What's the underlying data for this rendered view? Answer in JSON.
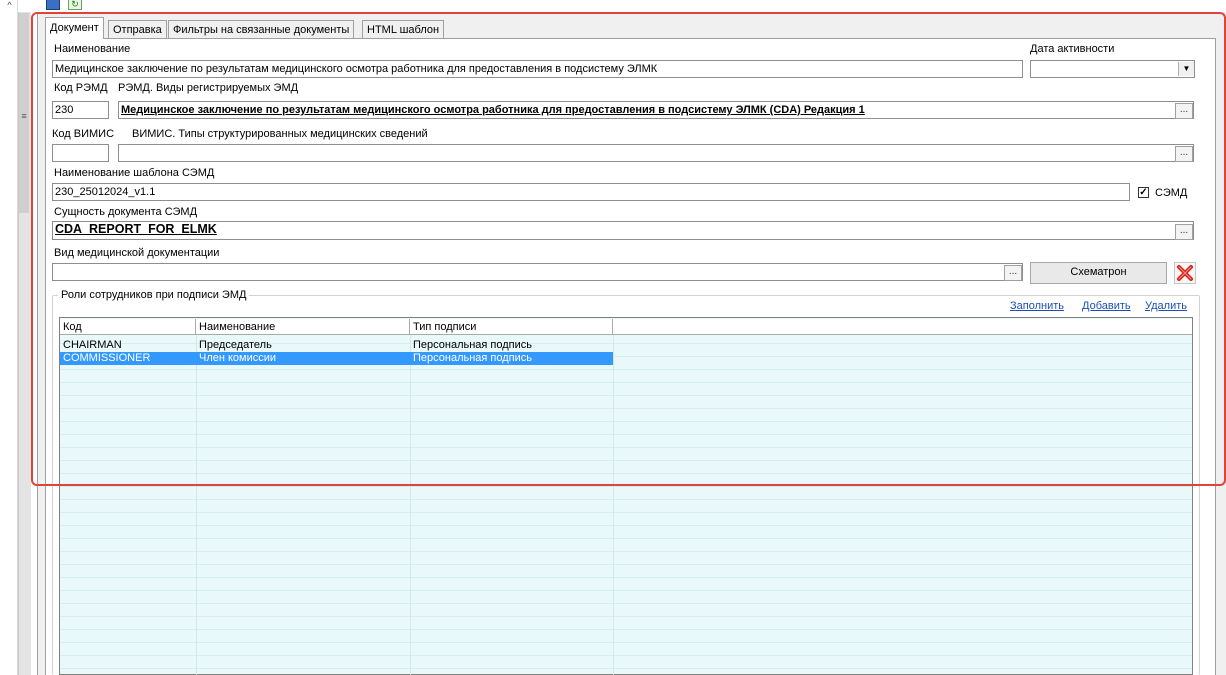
{
  "tabs": [
    {
      "label": "Документ",
      "active": true
    },
    {
      "label": "Отправка",
      "active": false
    },
    {
      "label": "Фильтры на связанные документы",
      "active": false
    },
    {
      "label": "HTML шаблон",
      "active": false
    }
  ],
  "form": {
    "name_label": "Наименование",
    "name_value": "Медицинское заключение по результатам медицинского осмотра работника для предоставления в подсистему ЭЛМК",
    "active_date_label": "Дата активности",
    "active_date_value": "",
    "remd_code_label": "Код РЭМД",
    "remd_types_label": "РЭМД. Виды регистрируемых ЭМД",
    "remd_code_value": "230",
    "remd_type_value": "Медицинское заключение по результатам медицинского осмотра работника для предоставления в подсистему ЭЛМК (CDA) Редакция 1",
    "vimis_code_label": "Код ВИМИС",
    "vimis_types_label": "ВИМИС. Типы структурированных медицинских сведений",
    "vimis_code_value": "",
    "vimis_type_value": "",
    "semd_template_label": "Наименование шаблона СЭМД",
    "semd_template_value": "230_25012024_v1.1",
    "semd_checkbox_label": "СЭМД",
    "semd_checkbox_checked": true,
    "semd_entity_label": "Сущность документа СЭМД",
    "semd_entity_value": "CDA_REPORT_FOR_ELMK",
    "med_doc_type_label": "Вид медицинской документации",
    "med_doc_type_value": "",
    "schematron_button": "Схематрон",
    "ellipsis": "..."
  },
  "roles": {
    "group_title": "Роли сотрудников при подписи ЭМД",
    "actions": {
      "fill": "Заполнить",
      "add": "Добавить",
      "delete": "Удалить"
    },
    "columns": [
      "Код",
      "Наименование",
      "Тип подписи"
    ],
    "rows": [
      {
        "code": "CHAIRMAN",
        "name": "Председатель",
        "sign_type": "Персональная подпись",
        "selected": false
      },
      {
        "code": "COMMISSIONER",
        "name": "Член комиссии",
        "sign_type": "Персональная подпись",
        "selected": true
      }
    ]
  },
  "icons": {
    "save": "save-icon",
    "refresh": "refresh-icon",
    "delete": "red-x-delete-icon",
    "scroll_up": "chevron-up-icon",
    "dropdown": "dropdown-arrow-icon",
    "checkbox": "checkbox-checked-icon"
  },
  "colors": {
    "selection": "#3399ff",
    "grid_bg": "#e9f8f8",
    "link": "#1a4fb5",
    "highlight_frame": "#e0433a"
  }
}
